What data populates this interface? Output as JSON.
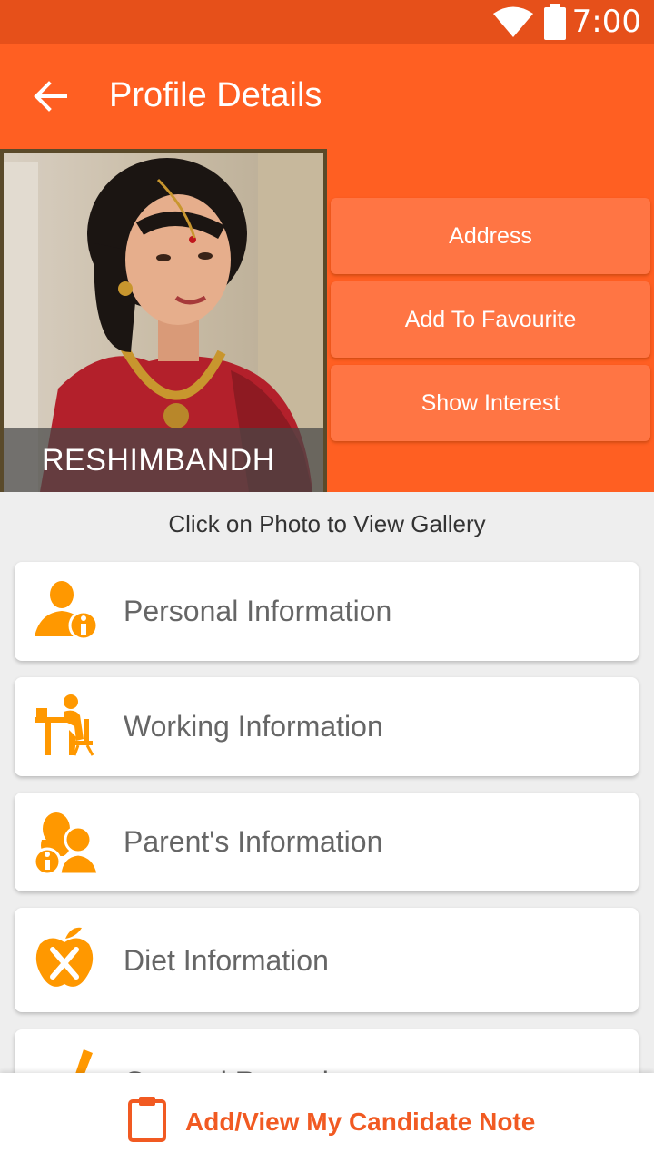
{
  "status_bar": {
    "time": "7:00"
  },
  "app_bar": {
    "title": "Profile Details"
  },
  "profile": {
    "photo_caption": "RESHIMBANDH"
  },
  "actions": {
    "address": "Address",
    "add_to_favourite": "Add To Favourite",
    "show_interest": "Show Interest"
  },
  "gallery_hint": "Click on Photo to View Gallery",
  "sections": [
    {
      "label": "Personal Information",
      "icon": "person-info-icon"
    },
    {
      "label": "Working Information",
      "icon": "person-at-desk-icon"
    },
    {
      "label": "Parent's Information",
      "icon": "parents-icon"
    },
    {
      "label": "Diet Information",
      "icon": "apple-cutlery-icon"
    },
    {
      "label": "General Remarks",
      "icon": "remarks-icon"
    }
  ],
  "bottom_bar": {
    "label": "Add/View My Candidate Note"
  },
  "colors": {
    "primary": "#ff5f22",
    "status_bar": "#e6501a",
    "button": "#ff7544",
    "icon": "#ff9800",
    "accent_text": "#f15a22"
  }
}
